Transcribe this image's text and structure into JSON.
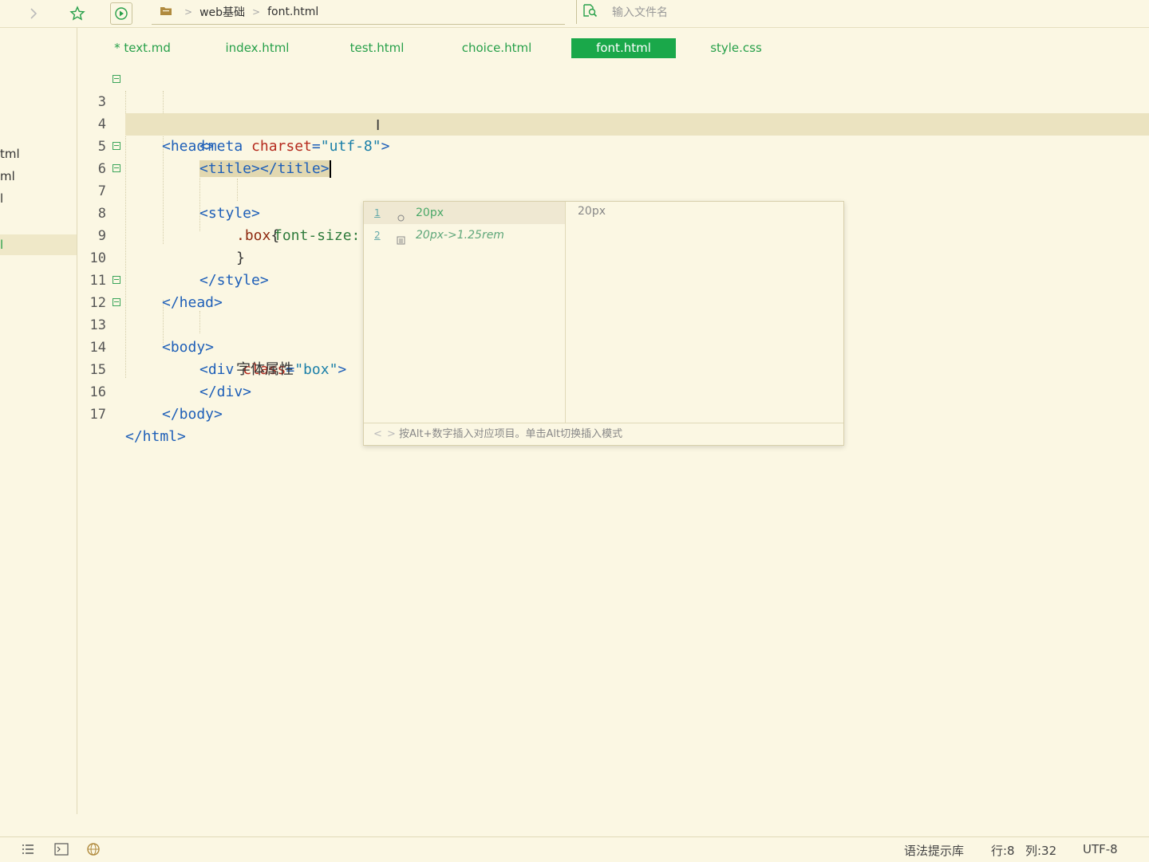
{
  "toolbar": {
    "breadcrumb": [
      "web基础",
      "font.html"
    ],
    "search_placeholder": "输入文件名"
  },
  "sidebar": {
    "items": [
      "tml",
      "ml",
      "l",
      "l"
    ]
  },
  "tabs": [
    {
      "label": "* text.md",
      "active": false
    },
    {
      "label": "index.html",
      "active": false
    },
    {
      "label": "test.html",
      "active": false
    },
    {
      "label": "choice.html",
      "active": false
    },
    {
      "label": "font.html",
      "active": true
    },
    {
      "label": "style.css",
      "active": false
    }
  ],
  "editor": {
    "line_numbers": [
      "3",
      "4",
      "5",
      "6",
      "7",
      "8",
      "9",
      "10",
      "11",
      "12",
      "13",
      "14",
      "15",
      "16",
      "17"
    ],
    "current_line": "5",
    "code": {
      "l3": {
        "t1": "<head>"
      },
      "l4": {
        "t1": "<meta ",
        "a1": "charset",
        "t2": "=",
        "s1": "\"utf-8\"",
        "t3": ">"
      },
      "l5": {
        "t1": "<title></title>"
      },
      "l6": {
        "t1": "<style>"
      },
      "l7": {
        "s1": ".box",
        "t1": "{"
      },
      "l8": {
        "p1": "font-size: ",
        "n1": "20",
        "u1": "px",
        "t1": ";"
      },
      "l9": {
        "t1": "}"
      },
      "l10": {
        "t1": "</style>"
      },
      "l11": {
        "t1": "</head>"
      },
      "l12": {
        "t1": "<body>"
      },
      "l13": {
        "t1": "<div ",
        "a1": "class",
        "t2": "=",
        "s1": "\"box\"",
        "t3": ">"
      },
      "l14": {
        "x1": "字体属性"
      },
      "l15": {
        "t1": "</div>"
      },
      "l16": {
        "t1": "</body>"
      },
      "l17": {
        "t1": "</html>"
      }
    }
  },
  "autocomplete": {
    "items": [
      {
        "num": "1",
        "text": "20px"
      },
      {
        "num": "2",
        "text": "20px->1.25rem"
      }
    ],
    "detail": "20px",
    "footer": "按Alt+数字插入对应项目。单击Alt切换插入模式"
  },
  "statusbar": {
    "syntax": "语法提示库",
    "row": "行:8",
    "col": "列:32",
    "encoding": "UTF-8"
  },
  "colors": {
    "accent": "#1aa84a",
    "background": "#fbf7e3"
  }
}
